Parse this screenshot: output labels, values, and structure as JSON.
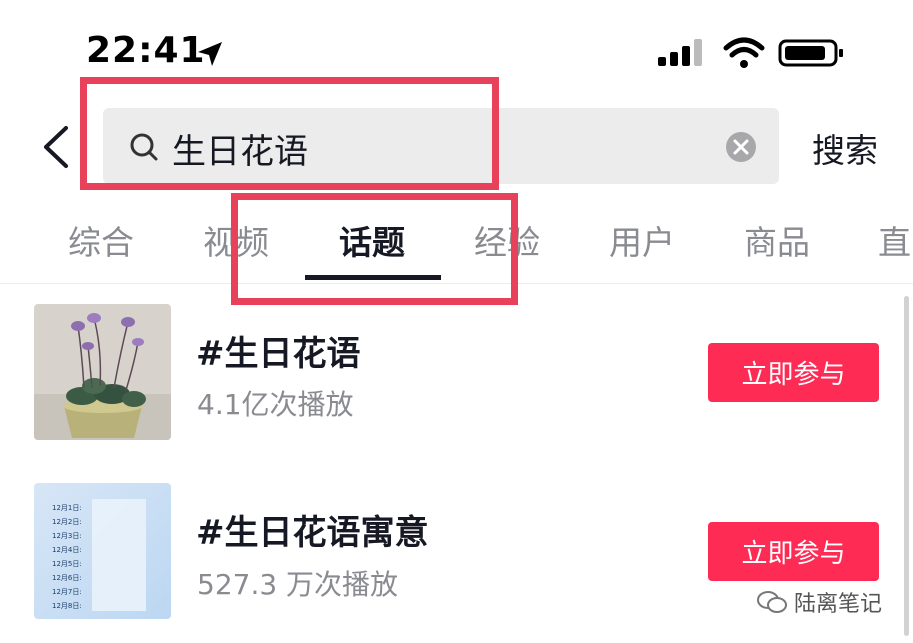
{
  "status_bar": {
    "time": "22:41"
  },
  "search": {
    "query": "生日花语",
    "button_label": "搜索"
  },
  "tabs": [
    {
      "label": "综合"
    },
    {
      "label": "视频"
    },
    {
      "label": "话题",
      "active": true
    },
    {
      "label": "经验"
    },
    {
      "label": "用户"
    },
    {
      "label": "商品"
    },
    {
      "label": "直"
    }
  ],
  "results": [
    {
      "title": "#生日花语",
      "plays": "4.1亿次播放",
      "action": "立即参与"
    },
    {
      "title": "#生日花语寓意",
      "plays": "527.3 万次播放",
      "action": "立即参与"
    }
  ],
  "thumbnail_lines": [
    "12月1日:",
    "12月2日:",
    "12月3日:",
    "12月4日:",
    "12月5日:",
    "12月6日:",
    "12月7日:",
    "12月8日:"
  ],
  "watermark": {
    "text": "陆离笔记"
  },
  "colors": {
    "accent": "#fe2c55",
    "highlight": "#e8425a"
  }
}
